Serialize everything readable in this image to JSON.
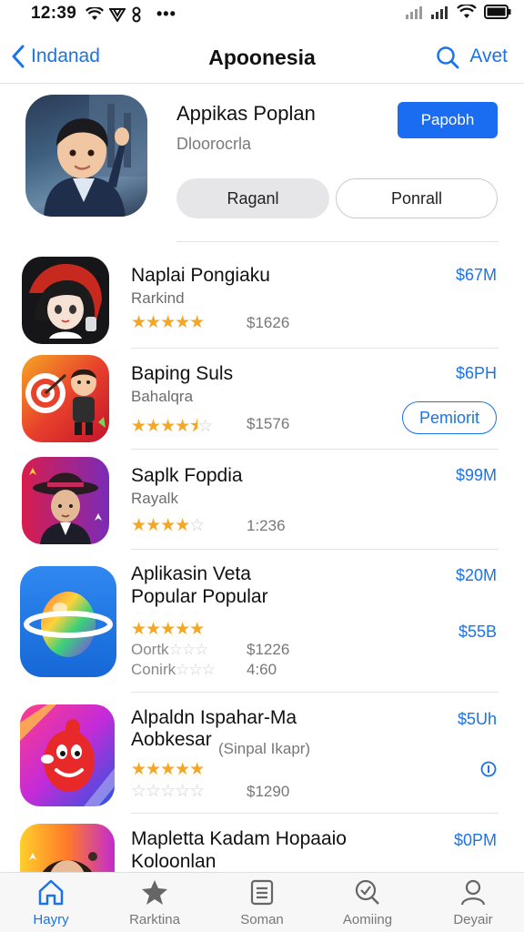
{
  "status_bar": {
    "time": "12:39",
    "dots": "•••"
  },
  "nav": {
    "back_label": "Indanad",
    "title": "Apoonesia",
    "right_label": "Avet"
  },
  "featured": {
    "name": "Appikas Poplan",
    "subtitle": "Dloorocrla",
    "primary_button": "Papobh",
    "segment_1": "Raganl",
    "segment_2": "Ponrall"
  },
  "apps": [
    {
      "title": "Naplai Pongiaku",
      "subtitle": "Rarkind",
      "price": "$67M",
      "rating": 5,
      "count": "$1626"
    },
    {
      "title": "Baping Suls",
      "subtitle": "Bahalqra",
      "price": "$6PH",
      "rating": 3.5,
      "count": "$1576",
      "button": "Pemiorit"
    },
    {
      "title": "Saplk Fopdia",
      "subtitle": "Rayalk",
      "price": "$99M",
      "rating": 4,
      "count": "1:236"
    },
    {
      "title": "Aplikasin Veta",
      "title_line2": "Popular Popular",
      "price": "$20M",
      "price2": "$55B",
      "rating": 5,
      "ghost1": "Oortk",
      "ghost2": "Conirk",
      "count": "$1226",
      "count2": "4:60"
    },
    {
      "title": "Alpaldn Ispahar-Ma",
      "title_line2": "Aobkesar",
      "subtitle_inline": "(Sinpal Ikapr)",
      "price": "$5Uh",
      "rating": 5,
      "count": "$1290"
    },
    {
      "title": "Mapletta Kadam Hopaaio",
      "title_line2": "Koloonlan",
      "price": "$0PM"
    }
  ],
  "tabs": [
    {
      "label": "Hayry",
      "icon": "home-icon",
      "active": true
    },
    {
      "label": "Rarktina",
      "icon": "star-icon",
      "active": false
    },
    {
      "label": "Soman",
      "icon": "list-icon",
      "active": false
    },
    {
      "label": "Aomiing",
      "icon": "search-check-icon",
      "active": false
    },
    {
      "label": "Deyair",
      "icon": "person-icon",
      "active": false
    }
  ],
  "colors": {
    "accent": "#1a73e8",
    "primary_button": "#1a6cf0",
    "star": "#f5a623"
  }
}
